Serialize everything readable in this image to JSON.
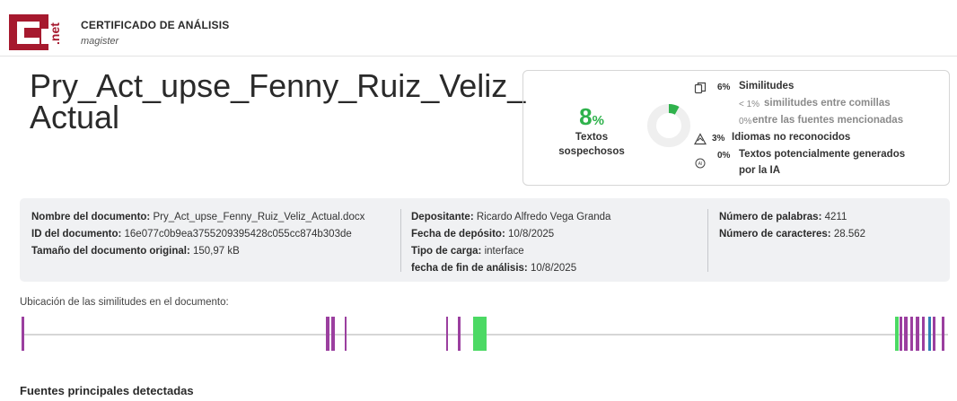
{
  "header": {
    "logo_text": "C.net",
    "title": "CERTIFICADO DE ANÁLISIS",
    "subtitle": "magister"
  },
  "document_title": "Pry_Act_upse_Fenny_Ruiz_Veliz_Actual",
  "score": {
    "percent": "8",
    "unit": "%",
    "label_line1": "Textos",
    "label_line2": "sospechosos",
    "value": 0.08,
    "accent_color": "#2fb24c"
  },
  "stats": [
    {
      "icon": "copy-icon",
      "pct": "6%",
      "label": "Similitudes"
    },
    {
      "icon": "",
      "pct": "< 1%",
      "label": "similitudes entre comillas"
    },
    {
      "icon": "",
      "pct": "0%",
      "label": "entre las fuentes mencionadas"
    },
    {
      "icon": "warning-icon",
      "pct": "3%",
      "label": "Idiomas no reconocidos"
    },
    {
      "icon": "ai-chip-icon",
      "pct": "0%",
      "label": "Textos potencialmente generados",
      "label2": "por la IA"
    }
  ],
  "info": {
    "col1": [
      {
        "k": "Nombre del documento:",
        "v": "Pry_Act_upse_Fenny_Ruiz_Veliz_Actual.docx"
      },
      {
        "k": "ID del documento:",
        "v": "16e077c0b9ea3755209395428c055cc874b303de"
      },
      {
        "k": "Tamaño del documento original:",
        "v": "150,97 kB"
      }
    ],
    "col2": [
      {
        "k": "Depositante:",
        "v": "Ricardo Alfredo Vega Granda"
      },
      {
        "k": "Fecha de depósito:",
        "v": "10/8/2025"
      },
      {
        "k": "Tipo de carga:",
        "v": "interface"
      },
      {
        "k": "fecha de fin de análisis:",
        "v": "10/8/2025"
      }
    ],
    "col3": [
      {
        "k": "Número de palabras:",
        "v": "4211"
      },
      {
        "k": "Número de caracteres:",
        "v": "28.562"
      }
    ]
  },
  "location_label": "Ubicación de las similitudes en el documento:",
  "sources_title": "Fuentes principales detectadas",
  "colors": {
    "similarity": "#9b3f9f",
    "language": "#4cd964",
    "ai": "#2f7fb8",
    "brand": "#a6192e"
  }
}
